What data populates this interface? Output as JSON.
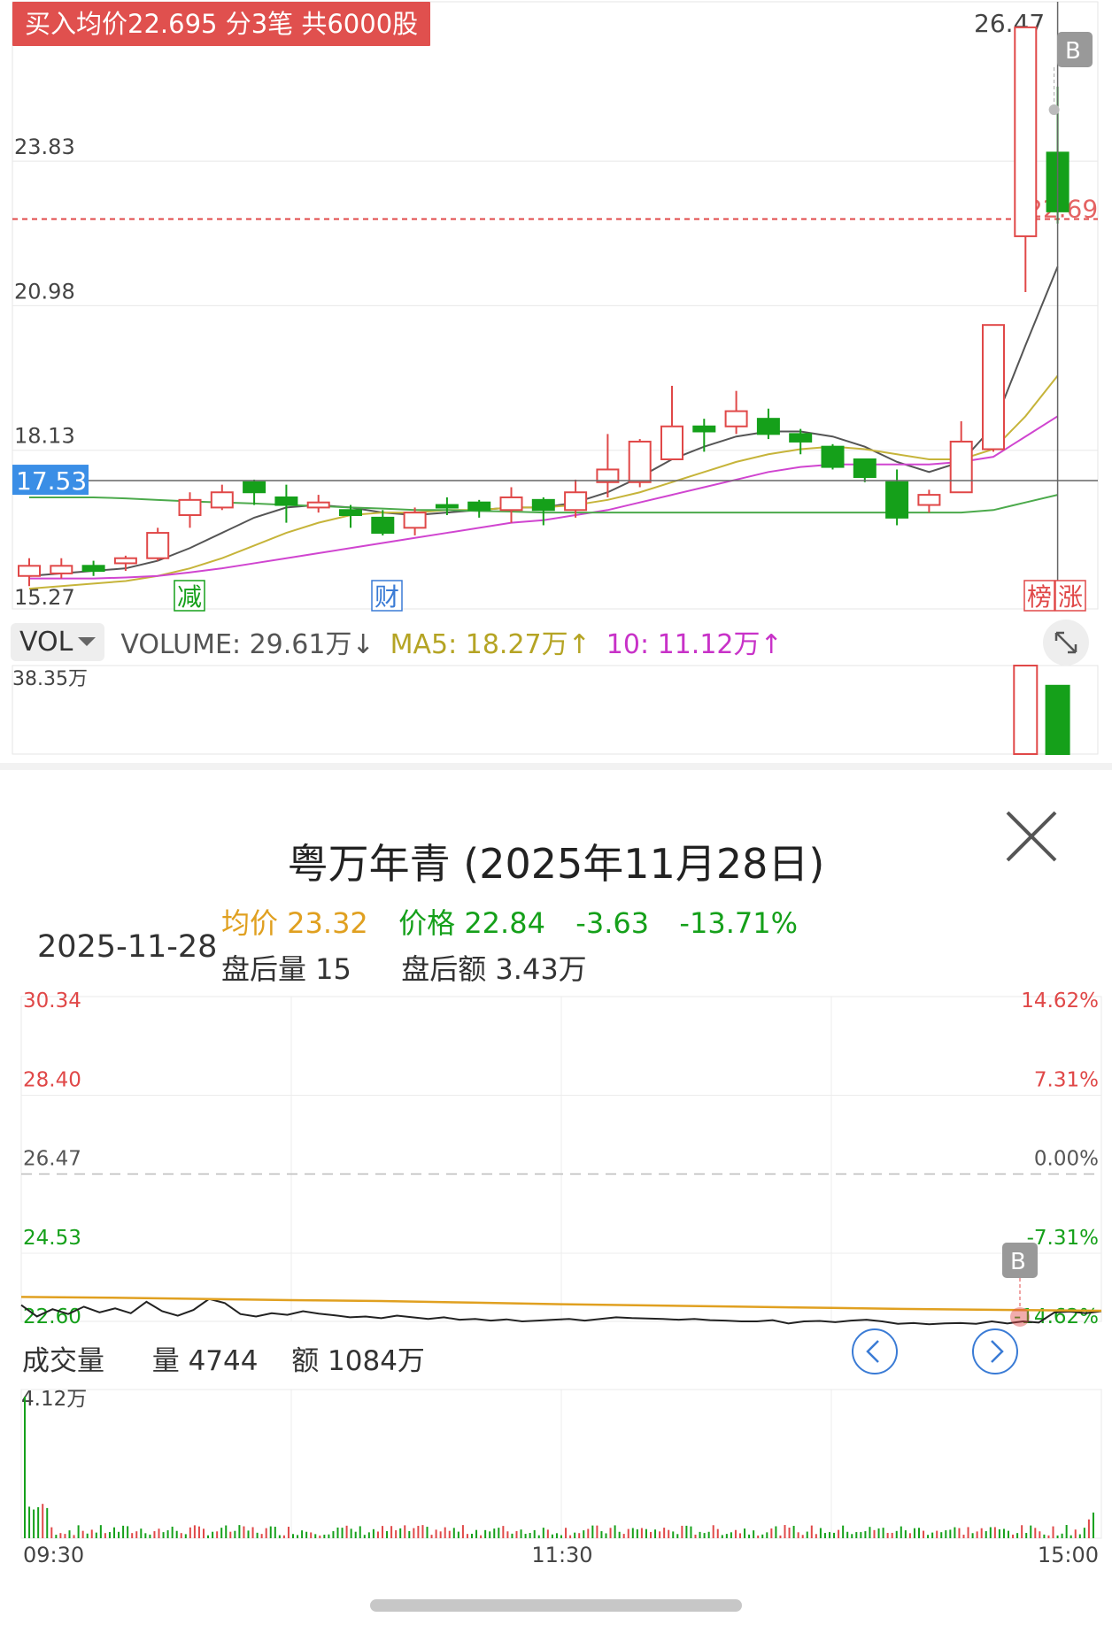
{
  "kline": {
    "trade_badge": "买入均价22.695 分3笔 共6000股",
    "price_labels": [
      "23.83",
      "20.98",
      "18.13",
      "15.27"
    ],
    "top_price": "26.47",
    "cost_line_label": "22.69",
    "crosshair_price": "17.53",
    "event_tags": [
      "减",
      "财",
      "榜",
      "涨"
    ],
    "buy_marker": "B",
    "vol_selector": "VOL",
    "vol_legend": [
      {
        "text": "VOLUME: 29.61万↓",
        "color": "#555555"
      },
      {
        "text": "MA5: 18.27万↑",
        "color": "#b5a424"
      },
      {
        "text": "10: 11.12万↑",
        "color": "#c832c8"
      }
    ],
    "vol_top_label": "38.35万",
    "colors": {
      "up": "#e04848",
      "down": "#15a01a",
      "ma_black": "#555555",
      "ma_yellow": "#c6b43a",
      "ma_magenta": "#d045d0",
      "ma_green": "#4caa4c"
    },
    "candles": [
      {
        "o": 15.65,
        "c": 15.85,
        "h": 16.0,
        "l": 15.45
      },
      {
        "o": 15.7,
        "c": 15.85,
        "h": 16.0,
        "l": 15.6
      },
      {
        "o": 15.85,
        "c": 15.75,
        "h": 15.95,
        "l": 15.65
      },
      {
        "o": 15.9,
        "c": 16.0,
        "h": 16.05,
        "l": 15.75
      },
      {
        "o": 16.0,
        "c": 16.5,
        "h": 16.6,
        "l": 15.95
      },
      {
        "o": 16.85,
        "c": 17.15,
        "h": 17.3,
        "l": 16.6
      },
      {
        "o": 17.0,
        "c": 17.3,
        "h": 17.45,
        "l": 16.95
      },
      {
        "o": 17.5,
        "c": 17.3,
        "h": 17.55,
        "l": 17.05
      },
      {
        "o": 17.2,
        "c": 17.05,
        "h": 17.45,
        "l": 16.7
      },
      {
        "o": 17.0,
        "c": 17.1,
        "h": 17.25,
        "l": 16.9
      },
      {
        "o": 16.95,
        "c": 16.85,
        "h": 17.05,
        "l": 16.6
      },
      {
        "o": 16.8,
        "c": 16.5,
        "h": 16.95,
        "l": 16.45
      },
      {
        "o": 16.6,
        "c": 16.9,
        "h": 17.0,
        "l": 16.45
      },
      {
        "o": 17.05,
        "c": 17.0,
        "h": 17.2,
        "l": 16.85
      },
      {
        "o": 17.1,
        "c": 16.95,
        "h": 17.15,
        "l": 16.8
      },
      {
        "o": 16.95,
        "c": 17.2,
        "h": 17.4,
        "l": 16.7
      },
      {
        "o": 17.15,
        "c": 16.95,
        "h": 17.2,
        "l": 16.65
      },
      {
        "o": 16.95,
        "c": 17.3,
        "h": 17.55,
        "l": 16.8
      },
      {
        "o": 17.5,
        "c": 17.75,
        "h": 18.45,
        "l": 17.2
      },
      {
        "o": 17.5,
        "c": 18.3,
        "h": 18.35,
        "l": 17.4
      },
      {
        "o": 17.95,
        "c": 18.6,
        "h": 19.4,
        "l": 17.95
      },
      {
        "o": 18.6,
        "c": 18.5,
        "h": 18.75,
        "l": 18.1
      },
      {
        "o": 18.6,
        "c": 18.9,
        "h": 19.3,
        "l": 18.45
      },
      {
        "o": 18.75,
        "c": 18.45,
        "h": 18.95,
        "l": 18.35
      },
      {
        "o": 18.45,
        "c": 18.3,
        "h": 18.55,
        "l": 18.05
      },
      {
        "o": 18.2,
        "c": 17.8,
        "h": 18.25,
        "l": 17.75
      },
      {
        "o": 17.95,
        "c": 17.6,
        "h": 17.95,
        "l": 17.5
      },
      {
        "o": 17.5,
        "c": 16.8,
        "h": 17.75,
        "l": 16.65
      },
      {
        "o": 17.05,
        "c": 17.25,
        "h": 17.35,
        "l": 16.9
      },
      {
        "o": 17.3,
        "c": 18.3,
        "h": 18.7,
        "l": 17.3
      },
      {
        "o": 18.15,
        "c": 20.6,
        "h": 20.6,
        "l": 18.1
      },
      {
        "o": 22.35,
        "c": 26.47,
        "h": 26.47,
        "l": 21.25
      },
      {
        "o": 24.0,
        "c": 22.84,
        "h": 25.3,
        "l": 22.6
      }
    ],
    "ma_black": [
      15.65,
      15.7,
      15.75,
      15.8,
      15.95,
      16.2,
      16.5,
      16.8,
      17.0,
      17.05,
      17.0,
      16.9,
      16.85,
      16.9,
      16.95,
      17.0,
      17.0,
      17.1,
      17.3,
      17.6,
      17.95,
      18.2,
      18.4,
      18.5,
      18.5,
      18.4,
      18.2,
      17.9,
      17.7,
      17.9,
      18.6,
      20.2,
      21.75
    ],
    "ma_yellow": [
      15.4,
      15.45,
      15.5,
      15.55,
      15.65,
      15.8,
      16.0,
      16.25,
      16.5,
      16.7,
      16.85,
      16.9,
      16.9,
      16.95,
      16.95,
      17.0,
      17.0,
      17.05,
      17.15,
      17.3,
      17.5,
      17.7,
      17.9,
      18.05,
      18.15,
      18.2,
      18.15,
      18.05,
      17.95,
      17.95,
      18.15,
      18.8,
      19.6
    ],
    "ma_magenta": [
      15.6,
      15.6,
      15.6,
      15.62,
      15.65,
      15.72,
      15.8,
      15.9,
      16.0,
      16.1,
      16.2,
      16.3,
      16.4,
      16.5,
      16.6,
      16.7,
      16.75,
      16.85,
      16.95,
      17.1,
      17.25,
      17.4,
      17.55,
      17.7,
      17.8,
      17.85,
      17.85,
      17.85,
      17.85,
      17.9,
      18.0,
      18.4,
      18.8
    ],
    "ma_green": [
      17.2,
      17.2,
      17.2,
      17.18,
      17.15,
      17.12,
      17.1,
      17.08,
      17.05,
      17.03,
      17.0,
      16.98,
      16.95,
      16.95,
      16.93,
      16.92,
      16.9,
      16.9,
      16.9,
      16.9,
      16.9,
      16.9,
      16.9,
      16.9,
      16.9,
      16.9,
      16.9,
      16.9,
      16.9,
      16.9,
      16.95,
      17.1,
      17.25
    ],
    "volume_tail": [
      {
        "v": 38.35,
        "up": true
      },
      {
        "v": 29.61,
        "up": false
      }
    ]
  },
  "sheet": {
    "title": "粤万年青 (2025年11月28日)",
    "date": "2025-11-28",
    "avg_price_label": "均价 23.32",
    "price_label": "价格 22.84",
    "change": "-3.63",
    "change_pct": "-13.71%",
    "after_hours_volume": "盘后量  15",
    "after_hours_amount": "盘后额  3.43万",
    "left_axis": [
      "30.34",
      "28.40",
      "26.47",
      "24.53",
      "22.60"
    ],
    "right_axis": [
      "14.62%",
      "7.31%",
      "0.00%",
      "-7.31%",
      "-14.62%"
    ],
    "buy_marker": "B",
    "volume_title": "成交量",
    "volume_qty": "量 4744",
    "volume_amount": "额 1084万",
    "vol_axis_top": "4.12万",
    "time_labels": [
      "09:30",
      "11:30",
      "15:00"
    ],
    "colors": {
      "avg": "#e0a020",
      "price": "#222222",
      "down": "#15a01a",
      "up": "#e04848"
    },
    "price_series": [
      23.0,
      22.72,
      22.9,
      22.78,
      22.96,
      22.82,
      22.92,
      22.8,
      23.08,
      22.85,
      22.74,
      22.88,
      23.15,
      23.05,
      22.78,
      22.72,
      22.8,
      22.76,
      22.85,
      22.79,
      22.75,
      22.7,
      22.72,
      22.68,
      22.74,
      22.7,
      22.66,
      22.7,
      22.64,
      22.66,
      22.62,
      22.65,
      22.6,
      22.62,
      22.64,
      22.66,
      22.62,
      22.66,
      22.7,
      22.68,
      22.67,
      22.66,
      22.64,
      22.66,
      22.63,
      22.62,
      22.6,
      22.6,
      22.63,
      22.55,
      22.6,
      22.61,
      22.58,
      22.62,
      22.64,
      22.6,
      22.54,
      22.56,
      22.53,
      22.55,
      22.56,
      22.54,
      22.6,
      22.55,
      22.6,
      22.57,
      22.82,
      22.84,
      22.8,
      22.85
    ],
    "avg_series": [
      23.2,
      23.18,
      23.15,
      23.12,
      23.1,
      23.06,
      23.02,
      22.99,
      22.96,
      22.93,
      22.9,
      22.88,
      22.86
    ]
  }
}
